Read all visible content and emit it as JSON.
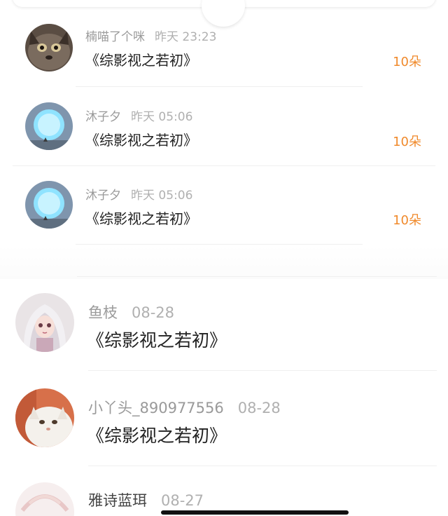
{
  "comments_compact": [
    {
      "user": "楠喵了个咪",
      "time": "昨天 23:23",
      "text": "《综影视之若初》",
      "flowers": "10朵",
      "avatar": "cat-dark"
    },
    {
      "user": "沐子夕",
      "time": "昨天 05:06",
      "text": "《综影视之若初》",
      "flowers": "10朵",
      "avatar": "moon-blue"
    },
    {
      "user": "沐子夕",
      "time": "昨天 05:06",
      "text": "《综影视之若初》",
      "flowers": "10朵",
      "avatar": "moon-blue"
    }
  ],
  "comments_large": [
    {
      "user": "鱼枝",
      "time": "08-28",
      "text": "《综影视之若初》",
      "avatar": "anime-girl"
    },
    {
      "user": "小丫头_890977556",
      "time": "08-28",
      "text": "《综影视之若初》",
      "avatar": "white-kitten"
    },
    {
      "user": "雅诗蓝珥",
      "time": "08-27",
      "text": "",
      "avatar": "anime-partial"
    }
  ],
  "colors": {
    "flower_orange": "#f08a2c",
    "meta_gray": "#9a9a9a",
    "title_dark": "#222222"
  }
}
